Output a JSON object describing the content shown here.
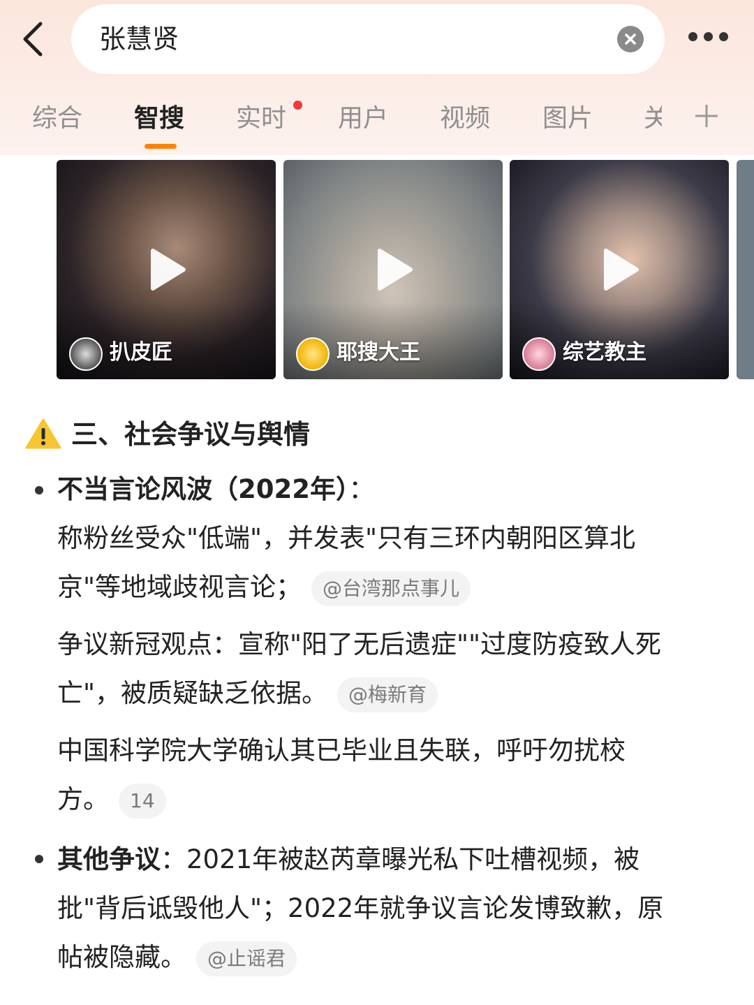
{
  "search": {
    "query": "张慧贤"
  },
  "tabs": [
    {
      "label": "综合"
    },
    {
      "label": "智搜"
    },
    {
      "label": "实时"
    },
    {
      "label": "用户"
    },
    {
      "label": "视频"
    },
    {
      "label": "图片"
    },
    {
      "label": "关"
    }
  ],
  "videos": [
    {
      "author": "扒皮匠"
    },
    {
      "author": "耶搜大王"
    },
    {
      "author": "综艺教主"
    }
  ],
  "section": {
    "title": "三、社会争议与舆情",
    "item1": {
      "heading": "不当言论风波（2022年）",
      "heading_colon": "：",
      "line1": "称粉丝受众\"低端\"，并发表\"只有三环内朝阳区算北",
      "line2": "京\"等地域歧视言论；",
      "source1": "@台湾那点事儿",
      "line3": "争议新冠观点：宣称\"阳了无后遗症\"\"过度防疫致人死",
      "line4": "亡\"，被质疑缺乏依据。",
      "source2": "@梅新育",
      "line5": "中国科学院大学确认其已毕业且失联，呼吁勿扰校",
      "line6": "方。",
      "source3": "14"
    },
    "item2": {
      "heading": "其他争议",
      "line1_rest": "：2021年被赵芮章曝光私下吐槽视频，被",
      "line2": "批\"背后诋毁他人\"；2022年就争议言论发博致歉，原",
      "line3": "帖被隐藏。",
      "source": "@止谣君"
    }
  }
}
